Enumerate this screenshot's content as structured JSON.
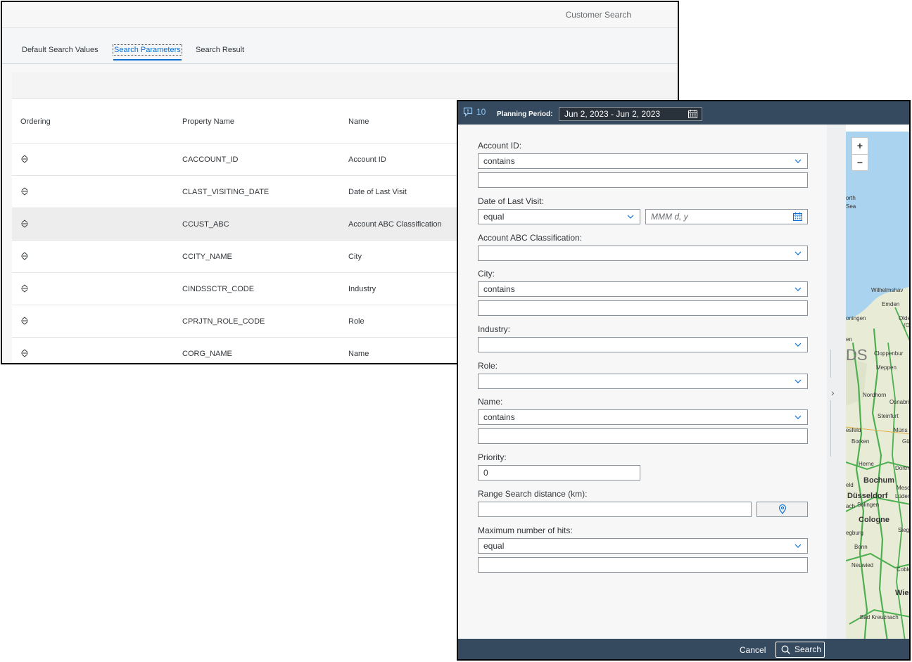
{
  "back_window": {
    "title": "Customer Search",
    "tabs": [
      {
        "label": "Default Search Values"
      },
      {
        "label": "Search Parameters",
        "active": true
      },
      {
        "label": "Search Result"
      }
    ],
    "table": {
      "headers": [
        "Ordering",
        "Property Name",
        "Name"
      ],
      "rows": [
        {
          "property": "CACCOUNT_ID",
          "name": "Account ID"
        },
        {
          "property": "CLAST_VISITING_DATE",
          "name": "Date of Last Visit"
        },
        {
          "property": "CCUST_ABC",
          "name": "Account ABC Classification",
          "selected": true
        },
        {
          "property": "CCITY_NAME",
          "name": "City"
        },
        {
          "property": "CINDSSCTR_CODE",
          "name": "Industry"
        },
        {
          "property": "CPRJTN_ROLE_CODE",
          "name": "Role"
        },
        {
          "property": "CORG_NAME",
          "name": "Name"
        }
      ]
    }
  },
  "dialog": {
    "header": {
      "notification_count": "10",
      "planning_label": "Planning Period:",
      "planning_value": "Jun 2, 2023 - Jun 2, 2023"
    },
    "fields": {
      "account_id": {
        "label": "Account ID:",
        "operator": "contains",
        "value": ""
      },
      "last_visit": {
        "label": "Date of Last Visit:",
        "operator": "equal",
        "date_placeholder": "MMM d, y"
      },
      "abc": {
        "label": "Account ABC Classification:",
        "value": ""
      },
      "city": {
        "label": "City:",
        "operator": "contains",
        "value": ""
      },
      "industry": {
        "label": "Industry:",
        "value": ""
      },
      "role": {
        "label": "Role:",
        "value": ""
      },
      "name": {
        "label": "Name:",
        "operator": "contains",
        "value": ""
      },
      "priority": {
        "label": "Priority:",
        "value": "0"
      },
      "range": {
        "label": "Range Search distance (km):",
        "value": ""
      },
      "max_hits": {
        "label": "Maximum number of hits:",
        "operator": "equal",
        "value": ""
      }
    },
    "map": {
      "zoom_in": "+",
      "zoom_out": "−",
      "labels": [
        "orth",
        "Sea",
        "Wilhelmshav",
        "Emden",
        "oningen",
        "Olden",
        "(Ol",
        "en",
        "Cloppenbur",
        "DS",
        "Meppen",
        "Nordhorn",
        "Osnabrüc",
        "Steinfurt",
        "esfeld",
        "Müns",
        "Borken",
        "Gü",
        "Herne",
        "Dortmu",
        "eld",
        "Bochum",
        "Düsseldorf",
        "Lüden",
        "ach",
        "Solingen",
        "Cologne",
        "Sieger",
        "egburg",
        "Bonn",
        "Neuwied",
        "Coble",
        "Wiesba",
        "Bad Kreuznach",
        "Mesc"
      ]
    },
    "footer": {
      "cancel": "Cancel",
      "search": "Search"
    },
    "colors": {
      "shell": "#354a5f",
      "accent": "#0a6ed1",
      "field_border": "#89919a"
    }
  }
}
